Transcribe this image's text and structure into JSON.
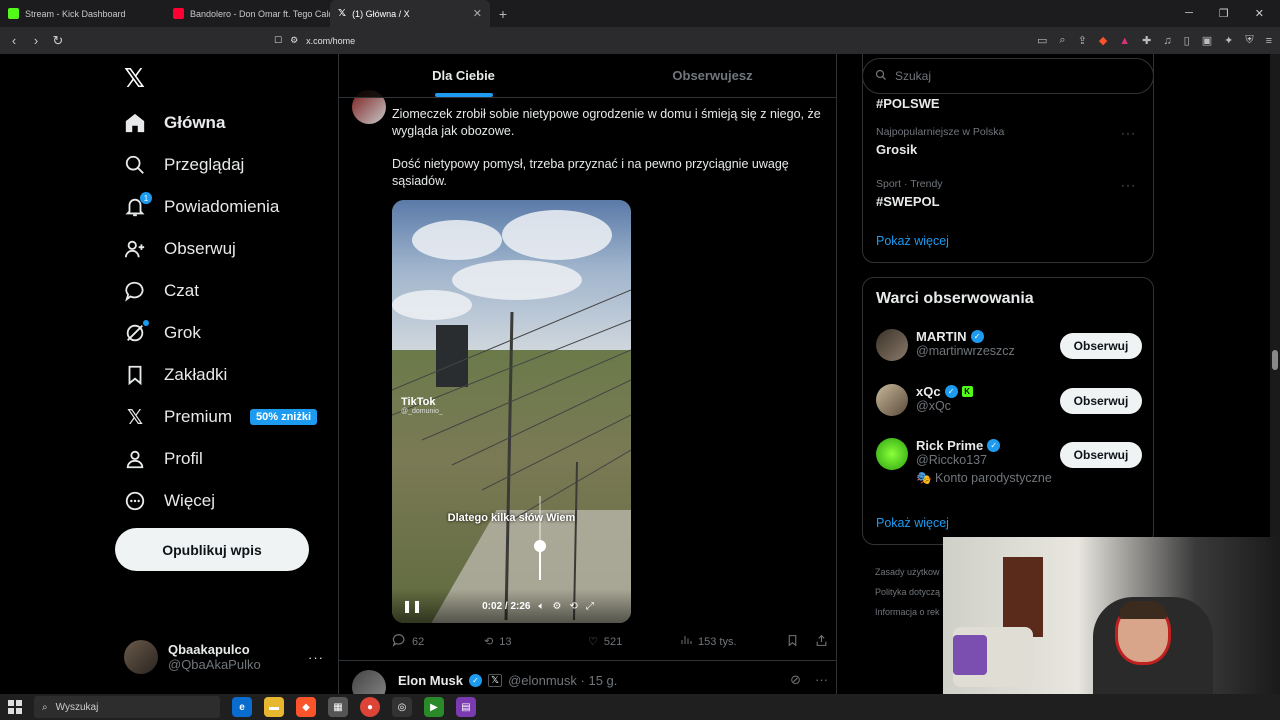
{
  "browser": {
    "tabs": [
      {
        "title": "Stream - Kick Dashboard",
        "color": "#53fc18"
      },
      {
        "title": "Bandolero - Don Omar ft. Tego Calde",
        "color": "#ff0033"
      },
      {
        "title": "(1) Główna / X",
        "color": "#ffffff"
      }
    ],
    "url": "x.com/home"
  },
  "nav": {
    "items": [
      {
        "label": "Główna",
        "icon": "home-icon"
      },
      {
        "label": "Przeglądaj",
        "icon": "search-icon"
      },
      {
        "label": "Powiadomienia",
        "icon": "bell-icon",
        "badge": "1"
      },
      {
        "label": "Obserwuj",
        "icon": "follow-icon"
      },
      {
        "label": "Czat",
        "icon": "chat-icon"
      },
      {
        "label": "Grok",
        "icon": "grok-icon"
      },
      {
        "label": "Zakładki",
        "icon": "bookmark-icon"
      },
      {
        "label": "Premium",
        "icon": "x-logo-icon",
        "promo": "50% zniżki"
      },
      {
        "label": "Profil",
        "icon": "person-icon"
      },
      {
        "label": "Więcej",
        "icon": "more-circle-icon"
      }
    ],
    "post_button": "Opublikuj wpis",
    "profile": {
      "name": "Qbaakapulco",
      "handle": "@QbaAkaPulko"
    }
  },
  "feed": {
    "tabs": [
      "Dla Ciebie",
      "Obserwujesz"
    ],
    "post": {
      "paragraph1": "Ziomeczek zrobił sobie nietypowe ogrodzenie w domu i śmieją się z niego, że wygląda jak obozowe.",
      "paragraph2": "Dość nietypowy pomysł, trzeba przyznać i na pewno przyciągnie uwagę sąsiadów.",
      "video": {
        "watermark": "TikTok",
        "watermark_user": "@_domunio_",
        "subtitle": "Dlatego kilka słów Wiem",
        "time": "0:02 / 2:26",
        "volume": 0.4
      },
      "stats": {
        "replies": "62",
        "reposts": "13",
        "likes": "521",
        "views": "153 tys."
      }
    },
    "next_post": {
      "name": "Elon Musk",
      "handle": "@elonmusk · 15 g."
    }
  },
  "right": {
    "search_placeholder": "Szukaj",
    "trends": [
      {
        "meta": "",
        "name": "#POLSWE"
      },
      {
        "meta": "Najpopularniejsze w Polska",
        "name": "Grosik"
      },
      {
        "meta": "Sport · Trendy",
        "name": "#SWEPOL"
      }
    ],
    "show_more": "Pokaż więcej",
    "who_to_follow": {
      "title": "Warci obserwowania",
      "accounts": [
        {
          "name": "MARTIN",
          "handle": "@martinwrzeszcz",
          "button": "Obserwuj"
        },
        {
          "name": "xQc",
          "handle": "@xQc",
          "button": "Obserwuj"
        },
        {
          "name": "Rick Prime",
          "handle": "@Riccko137",
          "note": "🎭 Konto parodystyczne",
          "button": "Obserwuj"
        }
      ],
      "show_more": "Pokaż więcej"
    },
    "footer": [
      "Zasady użytkow",
      "Polityka dotyczą",
      "Informacja o rek"
    ]
  },
  "taskbar": {
    "search": "Wyszukaj"
  }
}
